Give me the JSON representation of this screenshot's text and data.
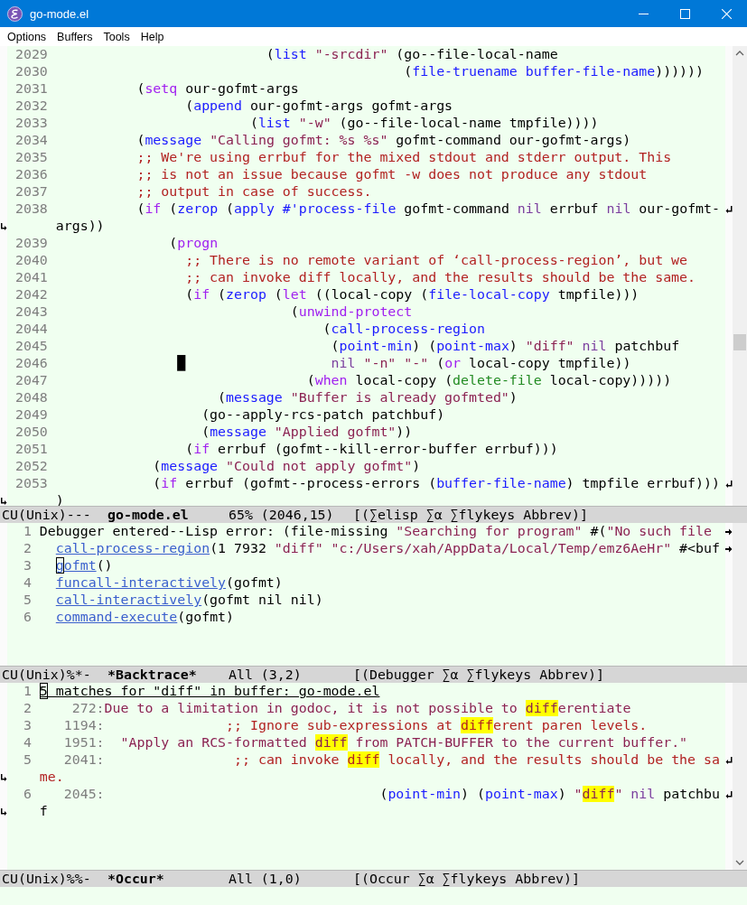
{
  "window": {
    "title": "go-mode.el"
  },
  "menu": [
    "Options",
    "Buffers",
    "Tools",
    "Help"
  ],
  "panes": [
    {
      "kind": "source",
      "lines": [
        {
          "number": "2029",
          "segments": [
            {
              "text": "                          (",
              "kind": "plain"
            },
            {
              "text": "list",
              "kind": "builtin"
            },
            {
              "text": " \"-srcdir\"",
              "kind": "string"
            },
            {
              "text": " (go--file-local-name",
              "kind": "plain"
            }
          ]
        },
        {
          "number": "2030",
          "segments": [
            {
              "text": "                                           (",
              "kind": "plain"
            },
            {
              "text": "file-truename buffer-file-name",
              "kind": "builtin"
            },
            {
              "text": "))))))",
              "kind": "plain"
            }
          ]
        },
        {
          "number": "2031",
          "segments": [
            {
              "text": "          (",
              "kind": "plain"
            },
            {
              "text": "setq",
              "kind": "keyword"
            },
            {
              "text": " our-gofmt-args",
              "kind": "plain"
            }
          ]
        },
        {
          "number": "2032",
          "segments": [
            {
              "text": "                (",
              "kind": "plain"
            },
            {
              "text": "append",
              "kind": "builtin"
            },
            {
              "text": " our-gofmt-args gofmt-args",
              "kind": "plain"
            }
          ]
        },
        {
          "number": "2033",
          "segments": [
            {
              "text": "                        (",
              "kind": "plain"
            },
            {
              "text": "list",
              "kind": "builtin"
            },
            {
              "text": " \"-w\"",
              "kind": "string"
            },
            {
              "text": " (go--file-local-name tmpfile))))",
              "kind": "plain"
            }
          ]
        },
        {
          "number": "2034",
          "segments": [
            {
              "text": "          (",
              "kind": "plain"
            },
            {
              "text": "message",
              "kind": "builtin"
            },
            {
              "text": " \"Calling gofmt: %s %s\"",
              "kind": "string"
            },
            {
              "text": " gofmt-command our-gofmt-args)",
              "kind": "plain"
            }
          ]
        },
        {
          "number": "2035",
          "segments": [
            {
              "text": "          ;; We're using errbuf for the mixed stdout and stderr output. This",
              "kind": "comment"
            }
          ]
        },
        {
          "number": "2036",
          "segments": [
            {
              "text": "          ;; is not an issue because gofmt -w does not produce any stdout",
              "kind": "comment"
            }
          ]
        },
        {
          "number": "2037",
          "segments": [
            {
              "text": "          ;; output in case of success.",
              "kind": "comment"
            }
          ]
        },
        {
          "number": "2038",
          "segments": [
            {
              "text": "          (",
              "kind": "plain"
            },
            {
              "text": "if",
              "kind": "keyword"
            },
            {
              "text": " (",
              "kind": "plain"
            },
            {
              "text": "zerop",
              "kind": "builtin"
            },
            {
              "text": " (",
              "kind": "plain"
            },
            {
              "text": "apply #'process-file",
              "kind": "builtin"
            },
            {
              "text": " gofmt-command ",
              "kind": "plain"
            },
            {
              "text": "nil",
              "kind": "constant"
            },
            {
              "text": " errbuf ",
              "kind": "plain"
            },
            {
              "text": "nil",
              "kind": "constant"
            },
            {
              "text": " our-gofmt-",
              "kind": "plain"
            }
          ],
          "continuation": [
            {
              "text": "args))",
              "kind": "plain"
            }
          ]
        },
        {
          "number": "2039",
          "segments": [
            {
              "text": "              (",
              "kind": "plain"
            },
            {
              "text": "progn",
              "kind": "keyword"
            }
          ]
        },
        {
          "number": "2040",
          "segments": [
            {
              "text": "                ;; There is no remote variant of ‘call-process-region’, but we",
              "kind": "comment"
            }
          ]
        },
        {
          "number": "2041",
          "segments": [
            {
              "text": "                ;; can invoke diff locally, and the results should be the same.",
              "kind": "comment"
            }
          ]
        },
        {
          "number": "2042",
          "segments": [
            {
              "text": "                (",
              "kind": "plain"
            },
            {
              "text": "if",
              "kind": "keyword"
            },
            {
              "text": " (",
              "kind": "plain"
            },
            {
              "text": "zerop",
              "kind": "builtin"
            },
            {
              "text": " (",
              "kind": "plain"
            },
            {
              "text": "let",
              "kind": "keyword"
            },
            {
              "text": " ((local-copy (",
              "kind": "plain"
            },
            {
              "text": "file-local-copy",
              "kind": "builtin"
            },
            {
              "text": " tmpfile)))",
              "kind": "plain"
            }
          ]
        },
        {
          "number": "2043",
          "segments": [
            {
              "text": "                             (",
              "kind": "plain"
            },
            {
              "text": "unwind-protect",
              "kind": "keyword"
            }
          ]
        },
        {
          "number": "2044",
          "segments": [
            {
              "text": "                                 (",
              "kind": "plain"
            },
            {
              "text": "call-process-region",
              "kind": "builtin"
            }
          ]
        },
        {
          "number": "2045",
          "segments": [
            {
              "text": "                                  (",
              "kind": "plain"
            },
            {
              "text": "point-min",
              "kind": "builtin"
            },
            {
              "text": ") (",
              "kind": "plain"
            },
            {
              "text": "point-max",
              "kind": "builtin"
            },
            {
              "text": ") ",
              "kind": "plain"
            },
            {
              "text": "\"diff\"",
              "kind": "string"
            },
            {
              "text": " nil",
              "kind": "constant"
            },
            {
              "text": " patchbuf",
              "kind": "plain"
            }
          ]
        },
        {
          "number": "2046",
          "segments": [
            {
              "text": "               █",
              "kind": "cursor"
            },
            {
              "text": "                  nil",
              "kind": "constant"
            },
            {
              "text": " \"-n\"",
              "kind": "string"
            },
            {
              "text": " \"-\"",
              "kind": "string"
            },
            {
              "text": " (",
              "kind": "plain"
            },
            {
              "text": "or",
              "kind": "keyword"
            },
            {
              "text": " local-copy tmpfile))",
              "kind": "plain"
            }
          ]
        },
        {
          "number": "2047",
          "segments": [
            {
              "text": "                               (",
              "kind": "plain"
            },
            {
              "text": "when",
              "kind": "keyword"
            },
            {
              "text": " local-copy (",
              "kind": "plain"
            },
            {
              "text": "delete-file",
              "kind": "function"
            },
            {
              "text": " local-copy)))))",
              "kind": "plain"
            }
          ]
        },
        {
          "number": "2048",
          "segments": [
            {
              "text": "                    (",
              "kind": "plain"
            },
            {
              "text": "message",
              "kind": "builtin"
            },
            {
              "text": " \"Buffer is already gofmted\"",
              "kind": "string"
            },
            {
              "text": ")",
              "kind": "plain"
            }
          ]
        },
        {
          "number": "2049",
          "segments": [
            {
              "text": "                  (go--apply-rcs-patch patchbuf)",
              "kind": "plain"
            }
          ]
        },
        {
          "number": "2050",
          "segments": [
            {
              "text": "                  (",
              "kind": "plain"
            },
            {
              "text": "message",
              "kind": "builtin"
            },
            {
              "text": " \"Applied gofmt\"",
              "kind": "string"
            },
            {
              "text": "))",
              "kind": "plain"
            }
          ]
        },
        {
          "number": "2051",
          "segments": [
            {
              "text": "                (",
              "kind": "plain"
            },
            {
              "text": "if",
              "kind": "keyword"
            },
            {
              "text": " errbuf (gofmt--kill-error-buffer errbuf)))",
              "kind": "plain"
            }
          ]
        },
        {
          "number": "2052",
          "segments": [
            {
              "text": "            (",
              "kind": "plain"
            },
            {
              "text": "message",
              "kind": "builtin"
            },
            {
              "text": " \"Could not apply gofmt\"",
              "kind": "string"
            },
            {
              "text": ")",
              "kind": "plain"
            }
          ]
        },
        {
          "number": "2053",
          "segments": [
            {
              "text": "            (",
              "kind": "plain"
            },
            {
              "text": "if",
              "kind": "keyword"
            },
            {
              "text": " errbuf (gofmt--process-errors (",
              "kind": "plain"
            },
            {
              "text": "buffer-file-name",
              "kind": "builtin"
            },
            {
              "text": ") tmpfile errbuf)))",
              "kind": "plain"
            }
          ],
          "continuation": [
            {
              "text": ")",
              "kind": "plain"
            }
          ]
        }
      ],
      "mode_line": {
        "status": "CU(Unix)---",
        "buffer": "go-mode.el",
        "position": "65% (2046,15)",
        "modes": "[(∑elisp ∑α ∑flykeys Abbrev)]"
      }
    },
    {
      "kind": "backtrace",
      "lines": [
        {
          "number": "1",
          "kind": "message",
          "truncated": true,
          "segments": [
            {
              "text": "Debugger entered--Lisp error: (file-missing ",
              "kind": "plain"
            },
            {
              "text": "\"Searching for program\"",
              "kind": "string"
            },
            {
              "text": " #(",
              "kind": "plain"
            },
            {
              "text": "\"No such file",
              "kind": "string"
            }
          ]
        },
        {
          "number": "2",
          "kind": "frame",
          "truncated": true,
          "segments": [
            {
              "text": "call-process-region",
              "kind": "link"
            },
            {
              "text": "(1 7932 ",
              "kind": "plain"
            },
            {
              "text": "\"diff\" \"c:/Users/xah/AppData/Local/Temp/emz6AeHr\"",
              "kind": "string"
            },
            {
              "text": " #<buf",
              "kind": "plain"
            }
          ]
        },
        {
          "number": "3",
          "kind": "frame",
          "truncated": false,
          "segments": [
            {
              "text": "g",
              "kind": "link",
              "cursor": true
            },
            {
              "text": "ofmt",
              "kind": "link"
            },
            {
              "text": "()",
              "kind": "plain"
            }
          ]
        },
        {
          "number": "4",
          "kind": "frame",
          "truncated": false,
          "segments": [
            {
              "text": "funcall-interactively",
              "kind": "link"
            },
            {
              "text": "(gofmt)",
              "kind": "plain"
            }
          ]
        },
        {
          "number": "5",
          "kind": "frame",
          "truncated": false,
          "segments": [
            {
              "text": "call-interactively",
              "kind": "link"
            },
            {
              "text": "(gofmt nil nil)",
              "kind": "plain"
            }
          ]
        },
        {
          "number": "6",
          "kind": "frame",
          "truncated": false,
          "segments": [
            {
              "text": "command-execute",
              "kind": "link"
            },
            {
              "text": "(gofmt)",
              "kind": "plain"
            }
          ]
        }
      ],
      "mode_line": {
        "status": "CU(Unix)%*-",
        "buffer": "*Backtrace*",
        "position": "All (3,2)",
        "modes": "[(Debugger ∑α ∑flykeys Abbrev)]"
      }
    },
    {
      "kind": "occur",
      "lines": [
        {
          "number": "1",
          "segments": [
            {
              "text": "5",
              "kind": "header",
              "cursor": true
            },
            {
              "text": " matches for \"diff\" in buffer: go-mode.el",
              "kind": "header"
            }
          ]
        },
        {
          "number": "2",
          "segments": [
            {
              "text": "    272:",
              "kind": "lineref"
            },
            {
              "text": "Due to a limitation in godoc, it is not possible to ",
              "kind": "doc"
            },
            {
              "text": "diff",
              "kind": "doc",
              "highlight": true
            },
            {
              "text": "erentiate",
              "kind": "doc"
            }
          ]
        },
        {
          "number": "3",
          "segments": [
            {
              "text": "   1194:",
              "kind": "lineref"
            },
            {
              "text": "               ;; Ignore sub-expressions at ",
              "kind": "comment"
            },
            {
              "text": "diff",
              "kind": "comment",
              "highlight": true
            },
            {
              "text": "erent paren levels.",
              "kind": "comment"
            }
          ]
        },
        {
          "number": "4",
          "segments": [
            {
              "text": "   1951:",
              "kind": "lineref"
            },
            {
              "text": "  \"Apply an RCS-formatted ",
              "kind": "doc"
            },
            {
              "text": "diff",
              "kind": "doc",
              "highlight": true
            },
            {
              "text": " from PATCH-BUFFER to the current buffer.\"",
              "kind": "doc"
            }
          ]
        },
        {
          "number": "5",
          "segments": [
            {
              "text": "   2041:",
              "kind": "lineref"
            },
            {
              "text": "                ;; can invoke ",
              "kind": "comment"
            },
            {
              "text": "diff",
              "kind": "comment",
              "highlight": true
            },
            {
              "text": " locally, and the results should be the sa",
              "kind": "comment"
            }
          ],
          "continuation": [
            {
              "text": "me.",
              "kind": "comment"
            }
          ]
        },
        {
          "number": "6",
          "segments": [
            {
              "text": "   2045:",
              "kind": "lineref"
            },
            {
              "text": "                                  (",
              "kind": "plain"
            },
            {
              "text": "point-min",
              "kind": "builtin"
            },
            {
              "text": ") (",
              "kind": "plain"
            },
            {
              "text": "point-max",
              "kind": "builtin"
            },
            {
              "text": ") ",
              "kind": "plain"
            },
            {
              "text": "\"",
              "kind": "string"
            },
            {
              "text": "diff",
              "kind": "string",
              "highlight": true
            },
            {
              "text": "\"",
              "kind": "string"
            },
            {
              "text": " nil",
              "kind": "constant"
            },
            {
              "text": " patchbu",
              "kind": "plain"
            }
          ],
          "continuation": [
            {
              "text": "f",
              "kind": "plain"
            }
          ]
        }
      ],
      "mode_line": {
        "status": "CU(Unix)%%-",
        "buffer": "*Occur*",
        "position": "All (1,0)",
        "modes": "[(Occur ∑α ∑flykeys Abbrev)]"
      }
    }
  ]
}
